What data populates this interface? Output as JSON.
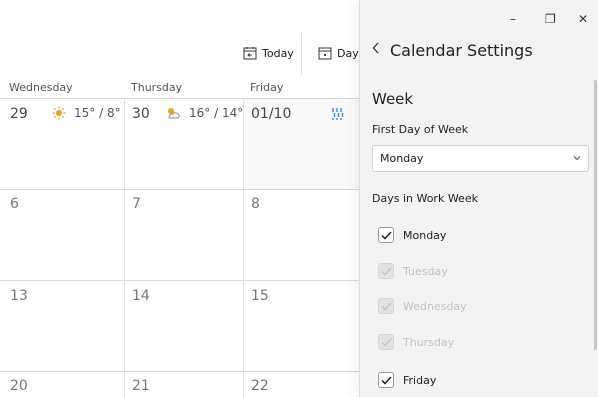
{
  "toolbar": {
    "today_label": "Today",
    "day_label": "Day"
  },
  "calendar": {
    "day_headers": [
      "Wednesday",
      "Thursday",
      "Friday"
    ],
    "weeks": [
      [
        "29",
        "30",
        "01/10"
      ],
      [
        "6",
        "7",
        "8"
      ],
      [
        "13",
        "14",
        "15"
      ],
      [
        "20",
        "21",
        "22"
      ]
    ],
    "weather": [
      {
        "icon": "sun-icon",
        "temp": "15° / 8°"
      },
      {
        "icon": "partly-cloudy-icon",
        "temp": "16° / 14°"
      },
      {
        "icon": "rain-icon"
      }
    ]
  },
  "window": {
    "minimize": "–",
    "restore": "❐",
    "close": "✕"
  },
  "settings": {
    "title": "Calendar Settings",
    "section": "Week",
    "first_day_label": "First Day of Week",
    "first_day_value": "Monday",
    "work_week_label": "Days in Work Week",
    "days": [
      {
        "label": "Monday",
        "checked": true,
        "enabled": true
      },
      {
        "label": "Tuesday",
        "checked": true,
        "enabled": false
      },
      {
        "label": "Wednesday",
        "checked": true,
        "enabled": false
      },
      {
        "label": "Thursday",
        "checked": true,
        "enabled": false
      },
      {
        "label": "Friday",
        "checked": true,
        "enabled": true
      }
    ]
  },
  "colors": {
    "sun": "#f0a020",
    "rain": "#3b7bd4",
    "panel_bg": "#f3f3f3"
  }
}
